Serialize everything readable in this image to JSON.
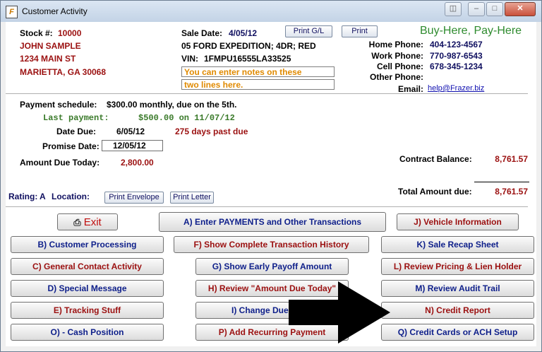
{
  "window": {
    "title": "Customer Activity",
    "app_icon_text": "F"
  },
  "customer": {
    "stock_label": "Stock #:",
    "stock_number": "10000",
    "name": "JOHN SAMPLE",
    "address": "1234 MAIN ST",
    "city_state_zip": "MARIETTA, GA 30068"
  },
  "vehicle": {
    "sale_date_label": "Sale Date:",
    "sale_date": "4/05/12",
    "description": "05 FORD EXPEDITION; 4DR; RED",
    "vin_label": "VIN:",
    "vin": "1FMPU16555LA33525"
  },
  "notes": {
    "line1": "You can enter notes on these",
    "line2": "two lines here."
  },
  "print": {
    "gl": "Print G/L",
    "print": "Print"
  },
  "dealer": {
    "tagline": "Buy-Here, Pay-Here"
  },
  "contact": {
    "home_label": "Home Phone:",
    "home": "404-123-4567",
    "work_label": "Work Phone:",
    "work": "770-987-6543",
    "cell_label": "Cell Phone:",
    "cell": "678-345-1234",
    "other_label": "Other Phone:",
    "other": "",
    "email_label": "Email:",
    "email": "help@Frazer.biz"
  },
  "payment": {
    "schedule_label": "Payment schedule:",
    "schedule": "$300.00 monthly, due on the 5th.",
    "last_payment_label": "Last payment:",
    "last_payment": "$500.00 on 11/07/12",
    "date_due_label": "Date Due:",
    "date_due": "6/05/12",
    "past_due": "275 days past due",
    "promise_label": "Promise Date:",
    "promise_date": "12/05/12",
    "amount_due_label": "Amount Due Today:",
    "amount_due": "2,800.00",
    "contract_balance_label": "Contract Balance:",
    "contract_balance": "8,761.57",
    "total_label": "Total Amount due:",
    "total": "8,761.57"
  },
  "rating": {
    "label": "Rating:",
    "value": "A",
    "location_label": "Location:",
    "print_envelope": "Print Envelope",
    "print_letter": "Print Letter"
  },
  "buttons": {
    "exit": "Exit",
    "a": "A) Enter PAYMENTS and Other Transactions",
    "j": "J) Vehicle Information",
    "b": "B) Customer Processing",
    "f": "F) Show Complete Transaction History",
    "k": "K) Sale Recap Sheet",
    "c": "C) General Contact Activity",
    "g": "G) Show Early Payoff Amount",
    "l": "L) Review Pricing & Lien Holder",
    "d": "D) Special Message",
    "h": "H) Review \"Amount Due Today\"",
    "m": "M) Review Audit Trail",
    "e": "E) Tracking Stuff",
    "i": "I) Change Due",
    "n": "N) Credit Report",
    "o": "O) - Cash Position",
    "p": "P) Add Recurring Payment",
    "q": "Q) Credit Cards or ACH Setup"
  },
  "colors": {
    "accent_green": "#2e8b2e",
    "maroon": "#9b1010",
    "navy": "#0e1f8a",
    "arrow": "#000000"
  }
}
